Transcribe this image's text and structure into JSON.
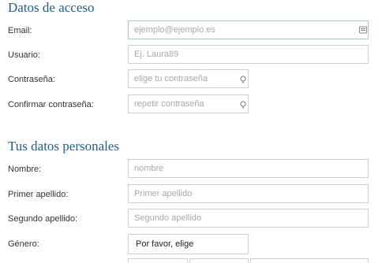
{
  "access": {
    "title": "Datos de acceso",
    "email": {
      "label": "Email:",
      "placeholder": "ejemplo@ejemplo.es"
    },
    "username": {
      "label": "Usuario:",
      "placeholder": "Ej. Laura89"
    },
    "password": {
      "label": "Contraseña:",
      "placeholder": "elige tu contraseña"
    },
    "confirm": {
      "label": "Confirmar contraseña:",
      "placeholder": "repetir contraseña"
    }
  },
  "personal": {
    "title": "Tus datos personales",
    "name": {
      "label": "Nombre:",
      "placeholder": "nombre"
    },
    "surname1": {
      "label": "Primer apellido:",
      "placeholder": "Primer apellido"
    },
    "surname2": {
      "label": "Segundo apellido:",
      "placeholder": "Segundo apellido"
    },
    "gender": {
      "label": "Género:",
      "selected": "Por favor, elige"
    }
  },
  "icons": {
    "email_field": "contact-card-icon",
    "password_field": "key-icon"
  },
  "colors": {
    "heading": "#1f5f86",
    "field_border": "#cfcfcf",
    "focus_border": "#a7c6d6"
  }
}
